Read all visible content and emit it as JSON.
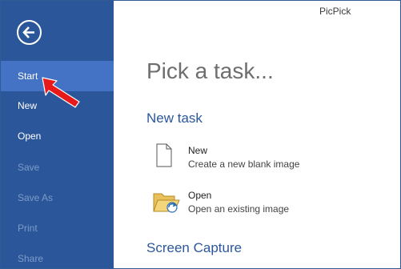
{
  "app": {
    "title": "PicPick"
  },
  "sidebar": {
    "back_icon": "back-arrow-icon",
    "items": [
      {
        "label": "Start",
        "state": "active"
      },
      {
        "label": "New",
        "state": "enabled"
      },
      {
        "label": "Open",
        "state": "enabled"
      },
      {
        "label": "Save",
        "state": "disabled"
      },
      {
        "label": "Save As",
        "state": "disabled"
      },
      {
        "label": "Print",
        "state": "disabled"
      },
      {
        "label": "Share",
        "state": "disabled"
      }
    ]
  },
  "main": {
    "heading": "Pick a task...",
    "sections": [
      {
        "title": "New task",
        "tasks": [
          {
            "title": "New",
            "description": "Create a new blank image",
            "icon": "blank-page-icon"
          },
          {
            "title": "Open",
            "description": "Open an existing image",
            "icon": "open-folder-icon"
          }
        ]
      },
      {
        "title": "Screen Capture"
      }
    ]
  },
  "colors": {
    "sidebar_bg": "#2b579a",
    "sidebar_active": "#4472c4",
    "accent": "#2b579a",
    "annotation_arrow": "#e8191b"
  }
}
